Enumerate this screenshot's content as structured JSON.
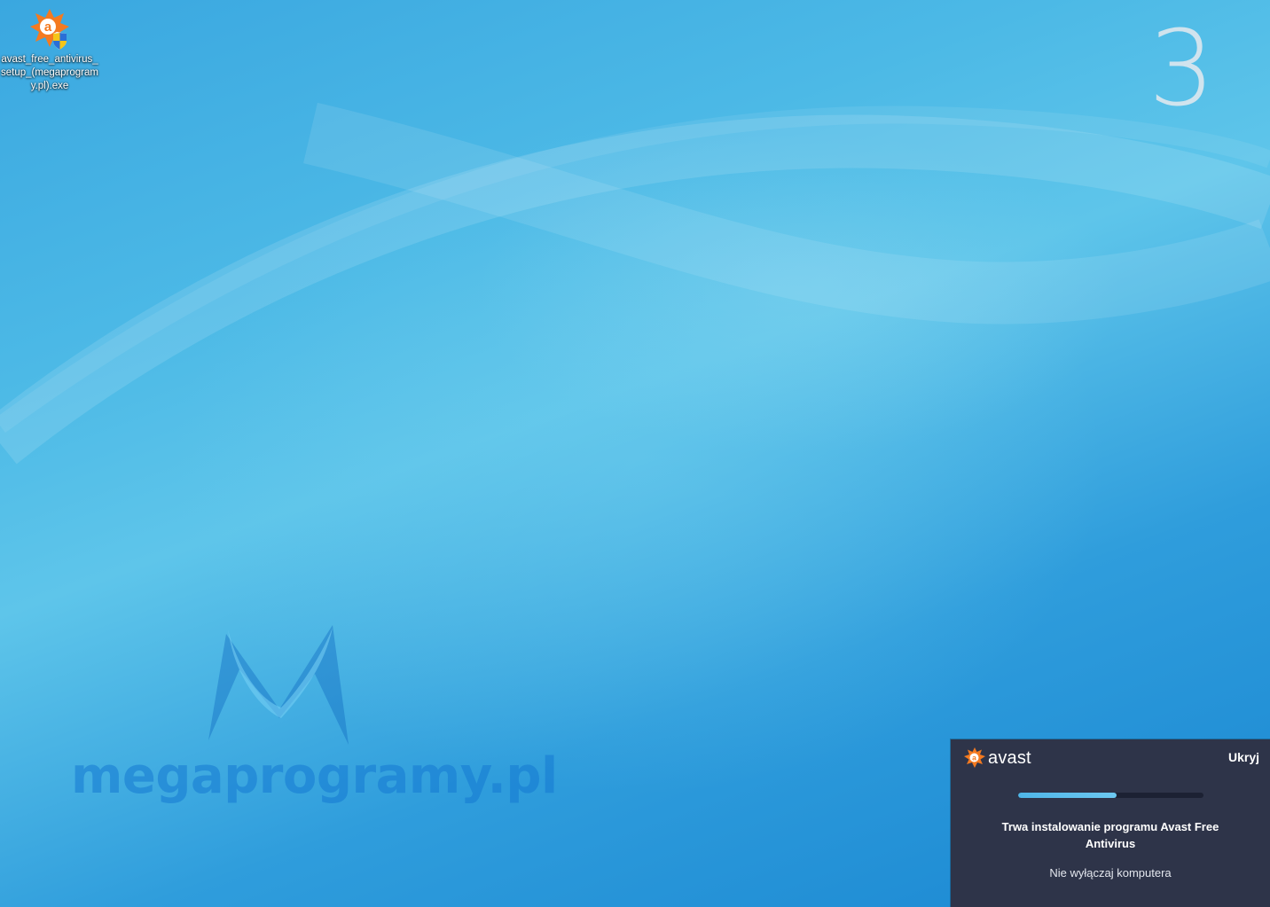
{
  "desktop": {
    "icon": {
      "name": "avast_free_antivirus_setup_(megaprogramy.pl).exe",
      "glyph": "avast-installer-icon"
    },
    "countdown": "3",
    "watermark": {
      "text": "megaprogramy.pl",
      "glyph": "megaprogramy-logo"
    }
  },
  "notification": {
    "brand": "avast",
    "hide_label": "Ukryj",
    "progress": 0.53,
    "status": "Trwa instalowanie programu Avast Free Antivirus",
    "subtext": "Nie wyłączaj komputera",
    "colors": {
      "background": "#2e3449",
      "accent": "#f47a20",
      "progress": "#4fb6e8"
    }
  }
}
